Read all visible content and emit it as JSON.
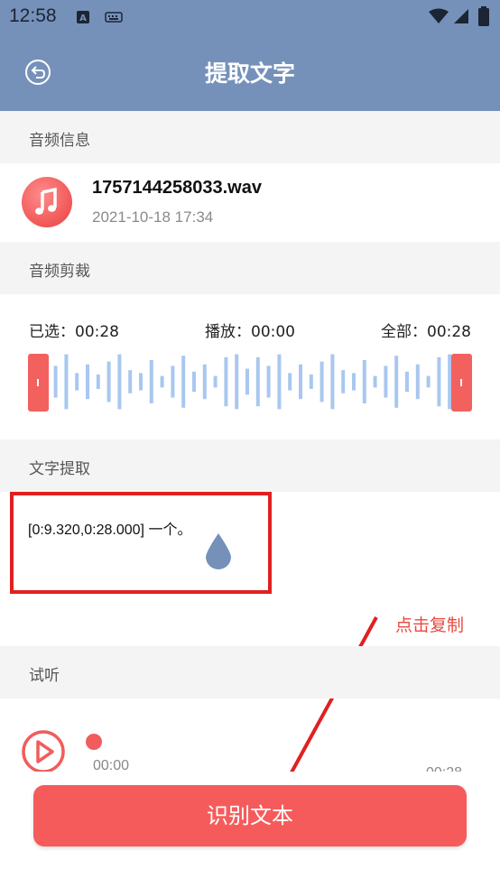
{
  "status_bar": {
    "time": "12:58"
  },
  "header": {
    "title": "提取文字"
  },
  "sections": {
    "audio_info": "音频信息",
    "audio_trim": "音频剪裁",
    "text_extract": "文字提取",
    "preview": "试听"
  },
  "file": {
    "name": "1757144258033.wav",
    "date": "2021-10-18 17:34"
  },
  "trim": {
    "selected": "已选：00:28",
    "playing": "播放：00:00",
    "total": "全部：00:28"
  },
  "extracted_text": "[0:9.320,0:28.000]  一个。",
  "annotation": {
    "hint": "点击复制"
  },
  "player": {
    "current": "00:00",
    "end": "00:28",
    "progress": 0
  },
  "main_button": "识别文本",
  "colors": {
    "accent": "#7591ba",
    "primary_button": "#f65b5b",
    "annotation_red": "#e02020",
    "wave_bar": "#a9c7ef"
  }
}
